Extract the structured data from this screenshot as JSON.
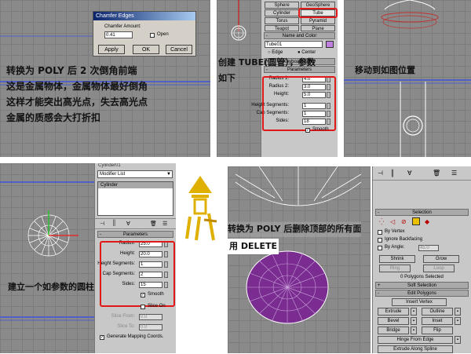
{
  "notes": {
    "panel1": [
      "转换为 POLY 后 2 次倒角前端",
      "这是金属物体，金属物体最好倒角",
      "这样才能突出高光点，失去高光点",
      "金属的质感会大打折扣"
    ],
    "panel2": [
      "创建 TUBE(圆管），参数",
      "如下"
    ],
    "panel3": "移动到如图位置",
    "panel4": "建立一个如参数的圆柱",
    "panel5": [
      "转换为 POLY 后删除顶部的所有面",
      "用 DELETE"
    ]
  },
  "logo_char": "剑",
  "chamfer_dialog": {
    "title": "Chamfer Edges",
    "amount_label": "Chamfer Amount:",
    "amount_value": "0.41",
    "open_label": "Open",
    "apply": "Apply",
    "ok": "OK",
    "cancel": "Cancel"
  },
  "tube_panel": {
    "object_types": [
      "Sphere",
      "GeoSphere",
      "Cylinder",
      "Tube",
      "Torus",
      "Pyramid",
      "Teapot",
      "Plane"
    ],
    "name_color_title": "Name and Color",
    "name_value": "Tube01",
    "edge_label": "Edge",
    "center_label": "Center",
    "keyboard_entry": "Keyboard Entry",
    "parameters_title": "Parameters",
    "params": [
      {
        "label": "Radius 1:",
        "value": "4.0"
      },
      {
        "label": "Radius 2:",
        "value": "3.0"
      },
      {
        "label": "Height:",
        "value": "5.0"
      },
      {
        "label": "Height Segments:",
        "value": "1"
      },
      {
        "label": "Cap Segments:",
        "value": "1"
      },
      {
        "label": "Sides:",
        "value": "18"
      }
    ],
    "smooth_label": "Smooth"
  },
  "cylinder_panel": {
    "header": "Cylinder01",
    "modifier_list": "Modifier List",
    "stack_item": "Cylinder",
    "parameters_title": "Parameters",
    "params": [
      {
        "label": "Radius:",
        "value": "25.0"
      },
      {
        "label": "Height:",
        "value": "20.0"
      },
      {
        "label": "Height Segments:",
        "value": "1"
      },
      {
        "label": "Cap Segments:",
        "value": "2"
      },
      {
        "label": "Sides:",
        "value": "15"
      }
    ],
    "smooth_label": "Smooth",
    "slice_on": "Slice On",
    "slice_from": "Slice From:",
    "slice_to": "Slice To:",
    "slice_from_value": "0.0",
    "slice_to_value": "0.0",
    "gen_mapping": "Generate Mapping Coords."
  },
  "poly_panel": {
    "selection_title": "Selection",
    "by_vertex": "By Vertex",
    "ignore_backfacing": "Ignore Backfacing",
    "by_angle": "By Angle:",
    "by_angle_value": "45.0",
    "shrink": "Shrink",
    "grow": "Grow",
    "ring": "Ring",
    "loop": "Loop",
    "status": "0 Polygons Selected",
    "soft_selection": "Soft Selection",
    "edit_polygons": "Edit Polygons",
    "insert_vertex": "Insert Vertex",
    "buttons": [
      [
        "Extrude",
        "Outline"
      ],
      [
        "Bevel",
        "Inset"
      ],
      [
        "Bridge",
        "Flip"
      ]
    ],
    "hinge": "Hinge From Edge",
    "extrude_spline": "Extrude Along Spline"
  },
  "colors": {
    "highlight_box": "#e01818",
    "selection_purple": "#7a2c90",
    "viewport": "#8a8a8a",
    "swatch_tube": "#c080e0"
  }
}
